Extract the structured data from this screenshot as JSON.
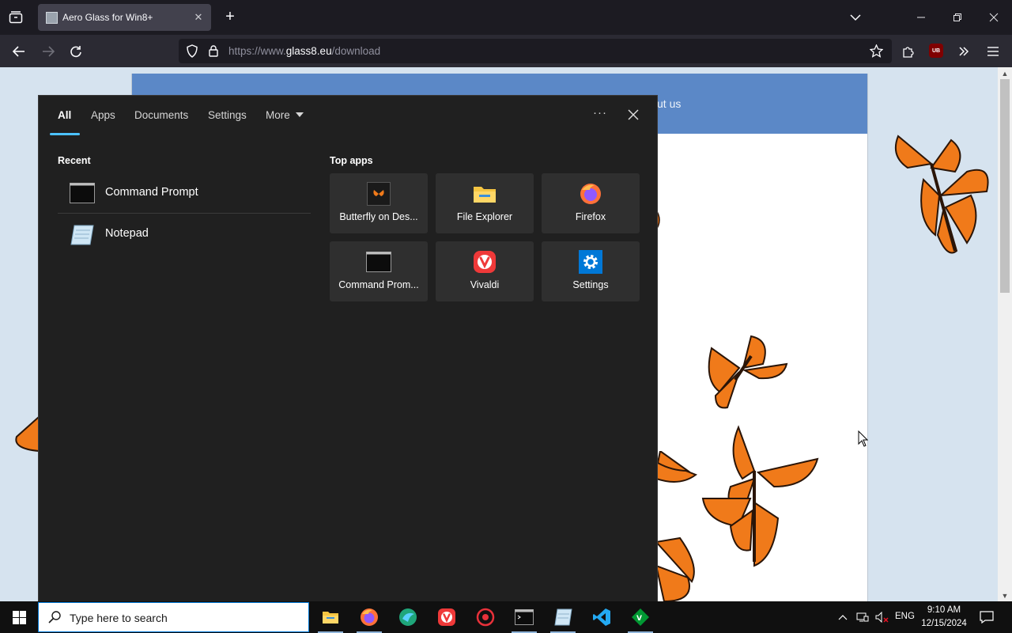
{
  "browser": {
    "tab_title": "Aero Glass for Win8+",
    "url_prefix": "https://www.",
    "url_host": "glass8.eu",
    "url_path": "/download",
    "ublock_label": "UB"
  },
  "website": {
    "nav_partial_text": "ut us"
  },
  "search_panel": {
    "tabs": [
      {
        "label": "All"
      },
      {
        "label": "Apps"
      },
      {
        "label": "Documents"
      },
      {
        "label": "Settings"
      },
      {
        "label": "More"
      }
    ],
    "more_menu_label": "···",
    "recent_heading": "Recent",
    "recent": [
      {
        "label": "Command Prompt",
        "icon": "command-prompt-icon"
      },
      {
        "label": "Notepad",
        "icon": "notepad-icon"
      }
    ],
    "top_apps_heading": "Top apps",
    "top_apps": [
      {
        "label": "Butterfly on Des...",
        "icon": "butterfly-icon"
      },
      {
        "label": "File Explorer",
        "icon": "folder-icon"
      },
      {
        "label": "Firefox",
        "icon": "firefox-icon"
      },
      {
        "label": "Command Prom...",
        "icon": "command-prompt-icon"
      },
      {
        "label": "Vivaldi",
        "icon": "vivaldi-icon"
      },
      {
        "label": "Settings",
        "icon": "settings-gear-icon"
      }
    ]
  },
  "taskbar": {
    "search_placeholder": "Type here to search",
    "language": "ENG",
    "time": "9:10 AM",
    "date": "12/15/2024",
    "pinned_apps": [
      "file-explorer",
      "firefox",
      "browser-green",
      "vivaldi",
      "davinci",
      "terminal",
      "notepad",
      "vscode",
      "vim"
    ]
  },
  "colors": {
    "accent_blue": "#4cc2ff",
    "panel_bg": "#202020",
    "site_nav_blue": "#5b88c7",
    "butterfly_orange": "#f07a1a"
  }
}
